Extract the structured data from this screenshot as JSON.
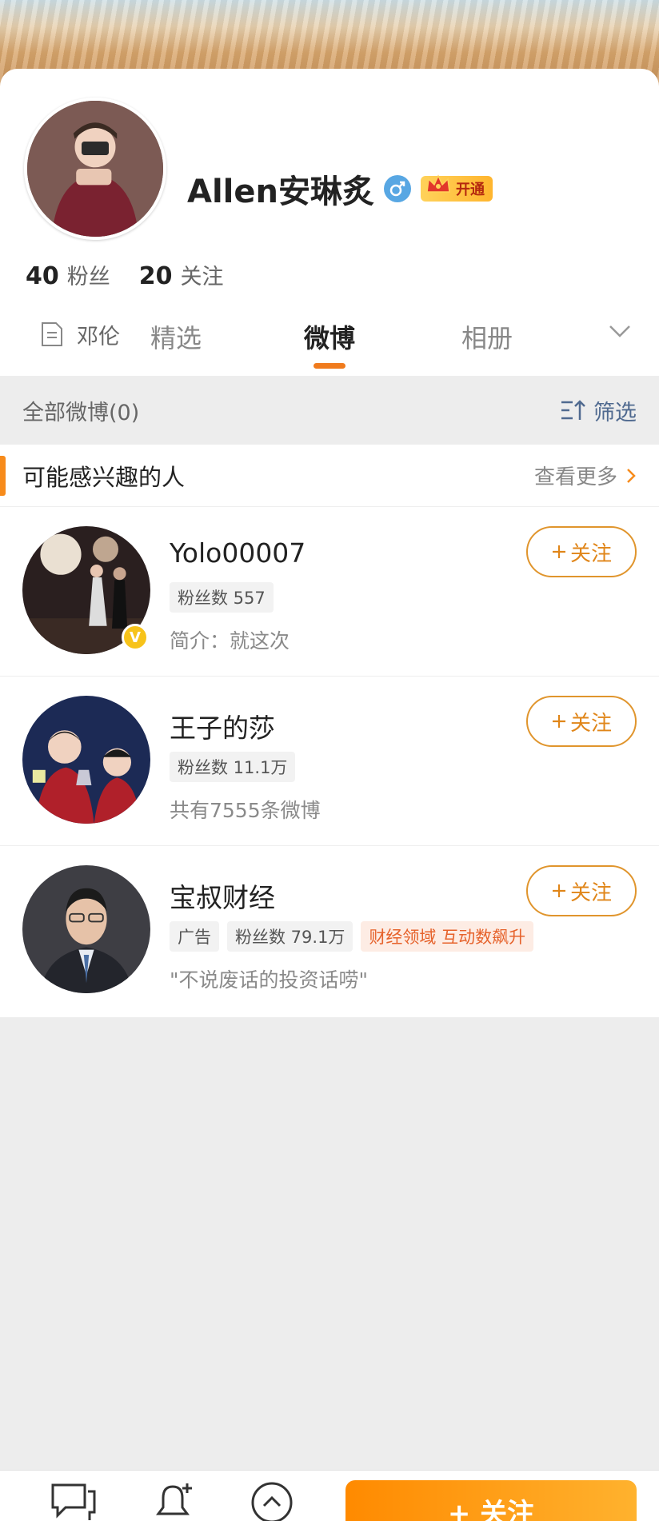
{
  "profile": {
    "username": "Allen安琳炙",
    "vip_label": "开通",
    "fans_count": "40",
    "fans_label": "粉丝",
    "following_count": "20",
    "following_label": "关注",
    "bio": "邓伦"
  },
  "tabs": [
    {
      "label": "精选",
      "active": false
    },
    {
      "label": "微博",
      "active": true
    },
    {
      "label": "相册",
      "active": false
    }
  ],
  "filter_bar": {
    "all_posts": "全部微博(0)",
    "filter_label": "筛选"
  },
  "suggest": {
    "title": "可能感兴趣的人",
    "see_more": "查看更多",
    "people": [
      {
        "name": "Yolo00007",
        "tags": [
          "粉丝数 557"
        ],
        "desc": "简介：就这次",
        "follow": "关注",
        "verified": "V"
      },
      {
        "name": "王子的莎",
        "tags": [
          "粉丝数 11.1万"
        ],
        "desc": "共有7555条微博",
        "follow": "关注"
      },
      {
        "name": "宝叔财经",
        "tags": [
          "广告",
          "粉丝数 79.1万",
          "财经领域 互动数飙升"
        ],
        "desc": "\"不说废话的投资话唠\"",
        "follow": "关注"
      }
    ]
  },
  "bottom_bar": {
    "follow_label": "+ 关注"
  },
  "colors": {
    "accent_orange": "#f07b1d",
    "follow_border": "#e0952d",
    "link_blue": "#506a90"
  },
  "icons": [
    "gender-male-icon",
    "crown-icon",
    "document-icon",
    "chevron-down-icon",
    "filter-icon",
    "chevron-right-icon",
    "plus-icon",
    "message-icon",
    "bell-plus-icon",
    "up-arrow-icon"
  ]
}
